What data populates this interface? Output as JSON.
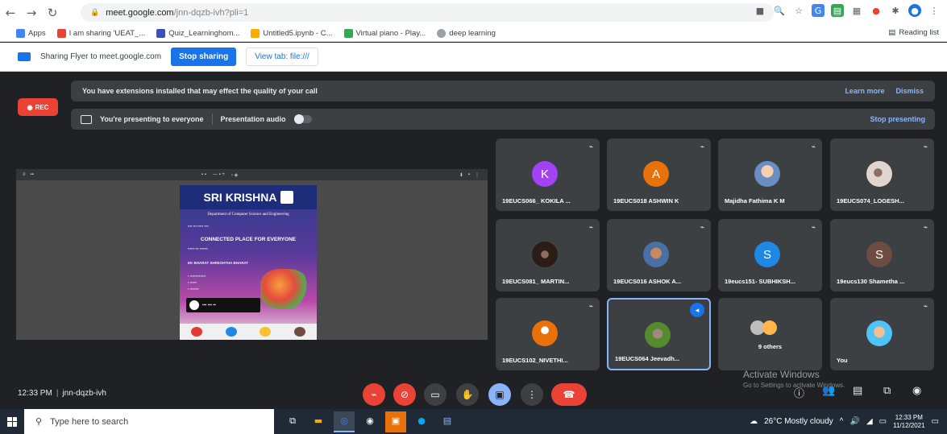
{
  "browser": {
    "url_host": "meet.google.com",
    "url_path": "/jnn-dqzb-ivh?pli=1",
    "bookmarks": [
      {
        "label": "Apps",
        "color": "#4285f4"
      },
      {
        "label": "I am sharing 'UEAT_...",
        "color": "#ea4335"
      },
      {
        "label": "Quiz_Learninghom...",
        "color": "#3f51b5"
      },
      {
        "label": "Untitled5.ipynb - C...",
        "color": "#f9ab00"
      },
      {
        "label": "Virtual piano - Play...",
        "color": "#34a853"
      },
      {
        "label": "deep learning",
        "color": "#9aa0a6"
      }
    ],
    "reading_list": "Reading list"
  },
  "share_bar": {
    "message": "Sharing Flyer to meet.google.com",
    "stop_label": "Stop sharing",
    "view_tab_label": "View tab: file:///"
  },
  "meet": {
    "extension_notice": "You have extensions installed that may effect the quality of your call",
    "learn_more": "Learn more",
    "dismiss": "Dismiss",
    "rec_label": "REC",
    "presenting_label": "You're presenting to everyone",
    "presentation_audio": "Presentation audio",
    "stop_presenting": "Stop presenting",
    "meeting_time": "12:33 PM",
    "meeting_code": "jnn-dqzb-ivh"
  },
  "slide": {
    "header": "SRI KRISHNA",
    "department": "Department of Computer Science and Engineering",
    "title": "CONNECTED PLACE FOR EVERYONE",
    "subtitle": "EK BHARAT SHRESHTHA BHARAT"
  },
  "participants": [
    {
      "name": "19EUCS066_ KOKILA ...",
      "initial": "K",
      "color": "#a142f4",
      "photo": false
    },
    {
      "name": "19EUCS018 ASHWIN K",
      "initial": "A",
      "color": "#e8710a",
      "photo": false
    },
    {
      "name": "Majidha Fathima K M",
      "initial": "",
      "color": "#8ab4f8",
      "photo": true
    },
    {
      "name": "19EUCS074_LOGESH...",
      "initial": "",
      "color": "#d7ccc8",
      "photo": true
    },
    {
      "name": "19EUCS081_ MARTIN...",
      "initial": "",
      "color": "#5d4037",
      "photo": true
    },
    {
      "name": "19EUCS016 ASHOK A...",
      "initial": "",
      "color": "#ffab91",
      "photo": true
    },
    {
      "name": "19eucs151- SUBHIKSH...",
      "initial": "S",
      "color": "#1e88e5",
      "photo": false
    },
    {
      "name": "19eucs130 Shametha ...",
      "initial": "S",
      "color": "#6d4c41",
      "photo": false
    },
    {
      "name": "19EUCS102_NIVETHI...",
      "initial": "",
      "color": "#e8710a",
      "photo": true
    },
    {
      "name": "19EUCS064 Jeevadh...",
      "initial": "",
      "color": "#7cb342",
      "photo": true
    },
    {
      "name": "9 others",
      "initial": "",
      "color": "#9aa0a6",
      "photo": true
    },
    {
      "name": "You",
      "initial": "",
      "color": "#ffcc80",
      "photo": true
    }
  ],
  "watermark": {
    "line1": "Activate Windows",
    "line2": "Go to Settings to activate Windows."
  },
  "taskbar": {
    "search_placeholder": "Type here to search",
    "weather": "26°C  Mostly cloudy",
    "time": "12:33 PM",
    "date": "11/12/2021"
  }
}
